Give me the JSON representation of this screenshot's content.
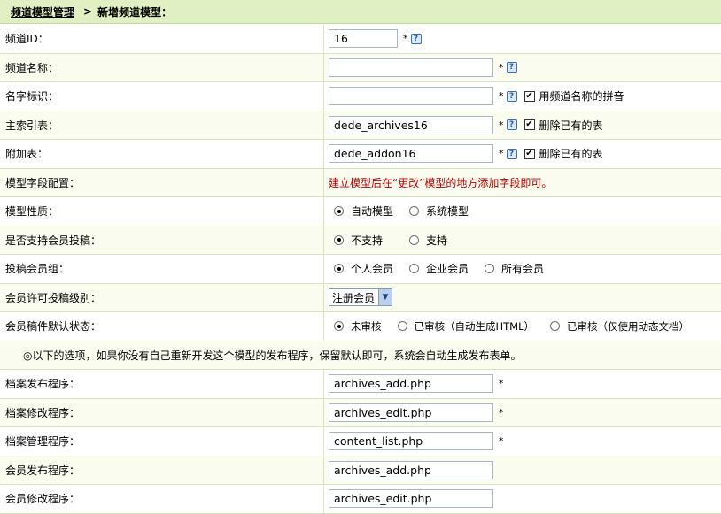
{
  "breadcrumb": {
    "root": "频道模型管理",
    "separator": ">",
    "current": "新增频道模型："
  },
  "fields": {
    "channel_id": {
      "label": "频道ID：",
      "value": "16",
      "required": "*"
    },
    "channel_name": {
      "label": "频道名称：",
      "value": "",
      "required": "*"
    },
    "name_tag": {
      "label": "名字标识：",
      "value": "",
      "required": "*",
      "checkbox_label": "用频道名称的拼音"
    },
    "main_table": {
      "label": "主索引表：",
      "value": "dede_archives16",
      "required": "*",
      "checkbox_label": "删除已有的表"
    },
    "addon_table": {
      "label": "附加表：",
      "value": "dede_addon16",
      "required": "*",
      "checkbox_label": "删除已有的表"
    },
    "field_config": {
      "label": "模型字段配置：",
      "note": "建立模型后在“更改”模型的地方添加字段即可。"
    },
    "model_type": {
      "label": "模型性质：",
      "options": [
        "自动模型",
        "系统模型"
      ]
    },
    "member_submit": {
      "label": "是否支持会员投稿：",
      "options": [
        "不支持",
        "支持"
      ]
    },
    "member_group": {
      "label": "投稿会员组：",
      "options": [
        "个人会员",
        "企业会员",
        "所有会员"
      ]
    },
    "member_level": {
      "label": "会员许可投稿级别：",
      "selected": "注册会员"
    },
    "member_status": {
      "label": "会员稿件默认状态：",
      "options": [
        "未审核",
        "已审核（自动生成HTML）",
        "已审核（仅使用动态文档）"
      ]
    }
  },
  "notice": "◎以下的选项，如果你没有自己重新开发这个模型的发布程序，保留默认即可，系统会自动生成发布表单。",
  "programs": {
    "archive_add": {
      "label": "档案发布程序：",
      "value": "archives_add.php",
      "required": "*"
    },
    "archive_edit": {
      "label": "档案修改程序：",
      "value": "archives_edit.php",
      "required": "*"
    },
    "archive_manage": {
      "label": "档案管理程序：",
      "value": "content_list.php",
      "required": "*"
    },
    "member_add": {
      "label": "会员发布程序：",
      "value": "archives_add.php"
    },
    "member_edit": {
      "label": "会员修改程序：",
      "value": "archives_edit.php"
    }
  },
  "icons": {
    "help": "?",
    "checkbox_check": "✔",
    "select_caret": "▼"
  },
  "colors": {
    "header_bg": "#e1f0c2",
    "note_red": "#c00000",
    "row_alt": "#f9fcef"
  }
}
